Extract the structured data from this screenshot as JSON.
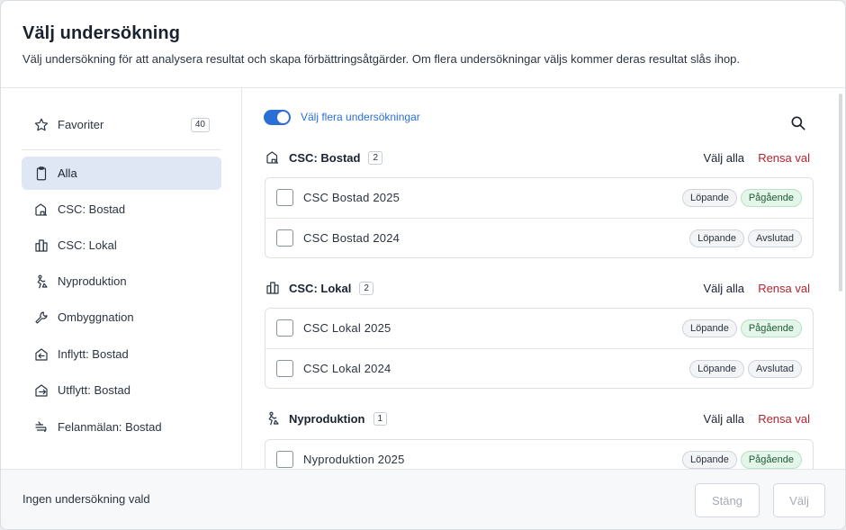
{
  "header": {
    "title": "Välj undersökning",
    "subtitle": "Välj undersökning för att analysera resultat och skapa förbättringsåtgärder. Om flera undersökningar väljs kommer deras resultat slås ihop."
  },
  "sidebar": {
    "favorites": {
      "label": "Favoriter",
      "count": "40",
      "icon": "star-icon"
    },
    "items": [
      {
        "label": "Alla",
        "icon": "clipboard-icon",
        "active": true
      },
      {
        "label": "CSC: Bostad",
        "icon": "house-icon"
      },
      {
        "label": "CSC: Lokal",
        "icon": "building-icon"
      },
      {
        "label": "Nyproduktion",
        "icon": "construction-worker-icon"
      },
      {
        "label": "Ombyggnation",
        "icon": "wrench-icon"
      },
      {
        "label": "Inflytt: Bostad",
        "icon": "move-in-icon"
      },
      {
        "label": "Utflytt: Bostad",
        "icon": "move-out-icon"
      },
      {
        "label": "Felanmälan: Bostad",
        "icon": "fault-report-icon"
      }
    ]
  },
  "main": {
    "toggle_label": "Välj flera undersökningar",
    "toggle_on": true,
    "select_all_label": "Välj alla",
    "clear_label": "Rensa val",
    "sections": [
      {
        "title": "CSC: Bostad",
        "count": "2",
        "icon": "house-icon",
        "rows": [
          {
            "label": "CSC Bostad 2025",
            "badges": [
              "Löpande",
              "Pågående"
            ]
          },
          {
            "label": "CSC Bostad 2024",
            "badges": [
              "Löpande",
              "Avslutad"
            ]
          }
        ]
      },
      {
        "title": "CSC: Lokal",
        "count": "2",
        "icon": "building-icon",
        "rows": [
          {
            "label": "CSC Lokal 2025",
            "badges": [
              "Löpande",
              "Pågående"
            ]
          },
          {
            "label": "CSC Lokal 2024",
            "badges": [
              "Löpande",
              "Avslutad"
            ]
          }
        ]
      },
      {
        "title": "Nyproduktion",
        "count": "1",
        "icon": "construction-worker-icon",
        "rows": [
          {
            "label": "Nyproduktion 2025",
            "badges": [
              "Löpande",
              "Pågående"
            ]
          }
        ]
      }
    ]
  },
  "footer": {
    "status": "Ingen undersökning vald",
    "close_label": "Stäng",
    "choose_label": "Välj"
  },
  "colors": {
    "accent": "#2b6fd6",
    "active_bg": "#dfe7f4",
    "danger": "#b52330",
    "ongoing_bg": "#e4f5ea"
  }
}
